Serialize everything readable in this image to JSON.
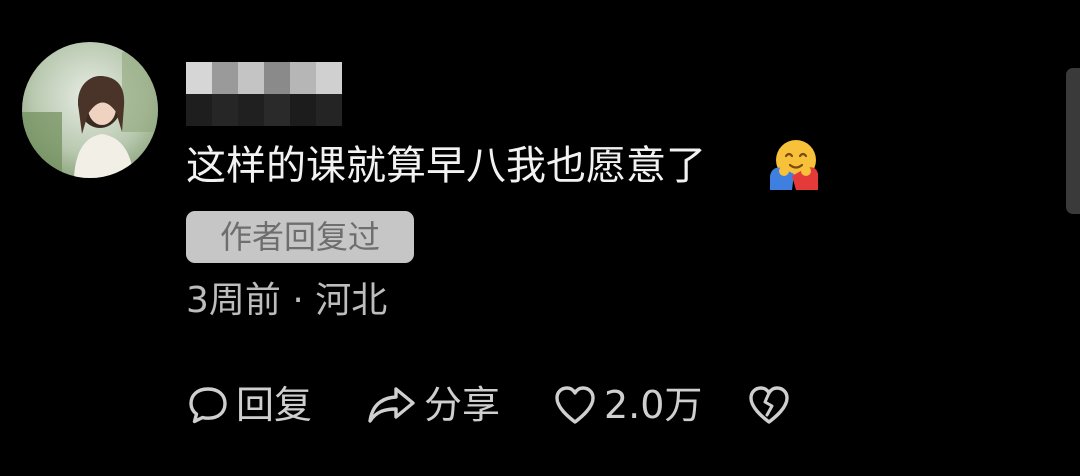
{
  "comment": {
    "text": "这样的课就算早八我也愿意了",
    "emoji": "hug-face-emoji",
    "author_badge": "作者回复过",
    "meta": "3周前 · 河北"
  },
  "actions": {
    "reply_label": "回复",
    "share_label": "分享",
    "like_count": "2.0万"
  },
  "colors": {
    "background": "#000000",
    "text": "#f2f2f2",
    "secondary_text": "#bdbdbd",
    "badge_bg": "#c6c6c6",
    "badge_text": "#6e6e6e"
  },
  "icons": {
    "reply": "speech-bubble-icon",
    "share": "share-arrow-icon",
    "like": "heart-outline-icon",
    "dislike": "broken-heart-icon"
  }
}
